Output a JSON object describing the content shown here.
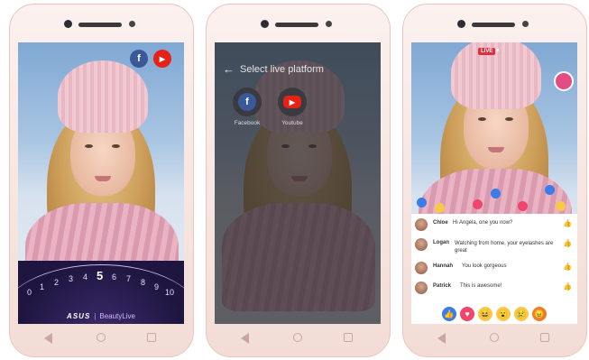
{
  "phone1": {
    "fb_icon": "f",
    "yt_icon": "▶",
    "dial_numbers": [
      "0",
      "1",
      "2",
      "3",
      "4",
      "5",
      "6",
      "7",
      "8",
      "9",
      "10"
    ],
    "brand": "ASUS",
    "brand_product": "BeautyLive",
    "gear": "⚙"
  },
  "phone2": {
    "title": "Select live platform",
    "back": "←",
    "platforms": [
      {
        "label": "Facebook",
        "glyph": "f",
        "color": "#3b5998"
      },
      {
        "label": "Youtube",
        "glyph": "▶",
        "color": "#e62117"
      }
    ]
  },
  "phone3": {
    "live_badge": "LIVE",
    "viewer_count": "●",
    "comments": [
      {
        "name": "Chloe",
        "text": "Hi Angela, one you now?"
      },
      {
        "name": "Logan",
        "text": "Watching from home, your eyelashes are great"
      },
      {
        "name": "Hannah",
        "text": "You look gorgeous"
      },
      {
        "name": "Patrick",
        "text": "This is awesome!"
      }
    ],
    "reactions": [
      {
        "name": "like",
        "glyph": "👍",
        "color": "#3b7bea"
      },
      {
        "name": "love",
        "glyph": "♥",
        "color": "#f0466b"
      },
      {
        "name": "haha",
        "glyph": "😆",
        "color": "#f7c948"
      },
      {
        "name": "wow",
        "glyph": "😮",
        "color": "#f7c948"
      },
      {
        "name": "sad",
        "glyph": "😢",
        "color": "#f7c948"
      },
      {
        "name": "angry",
        "glyph": "😠",
        "color": "#ef7b2a"
      }
    ]
  },
  "colors": {
    "facebook": "#3b5998",
    "youtube": "#e62117",
    "accent_pink": "#e64c84"
  }
}
